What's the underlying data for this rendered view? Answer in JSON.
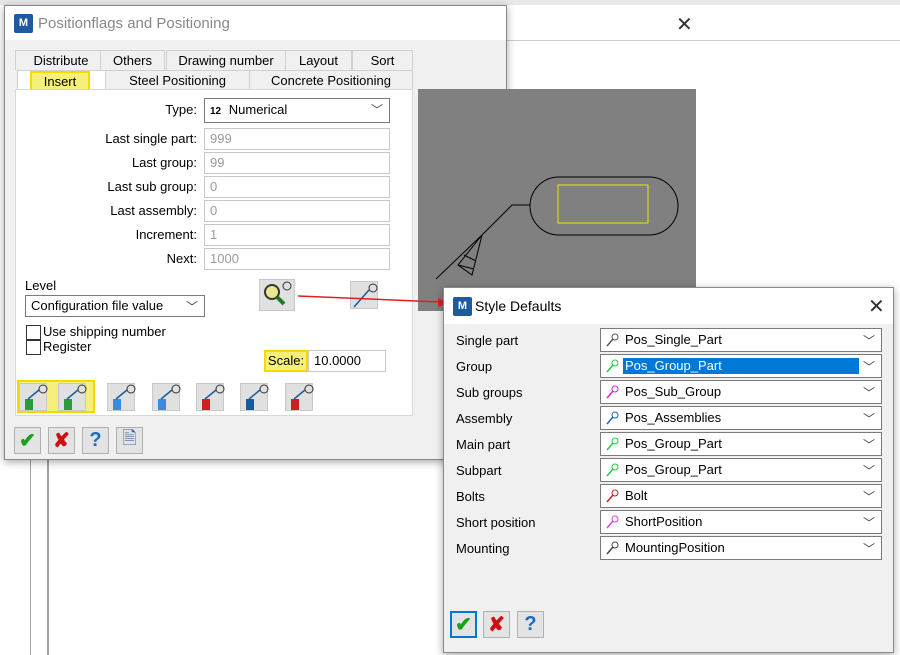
{
  "main_dialog": {
    "title": "Positionflags and Positioning",
    "tabs_row1": [
      "Distribute",
      "Others",
      "Drawing number",
      "Layout",
      "Sort"
    ],
    "tabs_row2": [
      "Insert",
      "Steel Positioning",
      "Concrete Positioning"
    ],
    "active_tab": "Insert",
    "type": {
      "label": "Type:",
      "icon_text": "12",
      "value": "Numerical"
    },
    "fields": [
      {
        "label": "Last single part:",
        "value": "999"
      },
      {
        "label": "Last group:",
        "value": "99"
      },
      {
        "label": "Last sub group:",
        "value": "0"
      },
      {
        "label": "Last assembly:",
        "value": "0"
      },
      {
        "label": "Increment:",
        "value": "1"
      },
      {
        "label": "Next:",
        "value": "1000"
      }
    ],
    "level": {
      "label": "Level",
      "value": "Configuration file value"
    },
    "checkboxes": [
      {
        "label": "Use shipping number",
        "checked": false
      },
      {
        "label": "Register",
        "checked": false
      }
    ],
    "scale": {
      "label": "Scale:",
      "value": "10.0000"
    }
  },
  "style_dialog": {
    "title": "Style Defaults",
    "rows": [
      {
        "label": "Single part",
        "value": "Pos_Single_Part",
        "color": "#555555"
      },
      {
        "label": "Group",
        "value": "Pos_Group_Part",
        "color": "#22cc44",
        "selected": true
      },
      {
        "label": "Sub groups",
        "value": "Pos_Sub_Group",
        "color": "#e020e0"
      },
      {
        "label": "Assembly",
        "value": "Pos_Assemblies",
        "color": "#2060c0"
      },
      {
        "label": "Main part",
        "value": "Pos_Group_Part",
        "color": "#22cc44"
      },
      {
        "label": "Subpart",
        "value": "Pos_Group_Part",
        "color": "#22cc44"
      },
      {
        "label": "Bolts",
        "value": "Bolt",
        "color": "#cc2020"
      },
      {
        "label": "Short position",
        "value": "ShortPosition",
        "color": "#e040e0"
      },
      {
        "label": "Mounting",
        "value": "MountingPosition",
        "color": "#444444"
      }
    ]
  },
  "colors": {
    "highlight": "#f5f07a",
    "selection": "#0078d7",
    "arrow": "#e02020",
    "preview_bg": "#808080"
  }
}
